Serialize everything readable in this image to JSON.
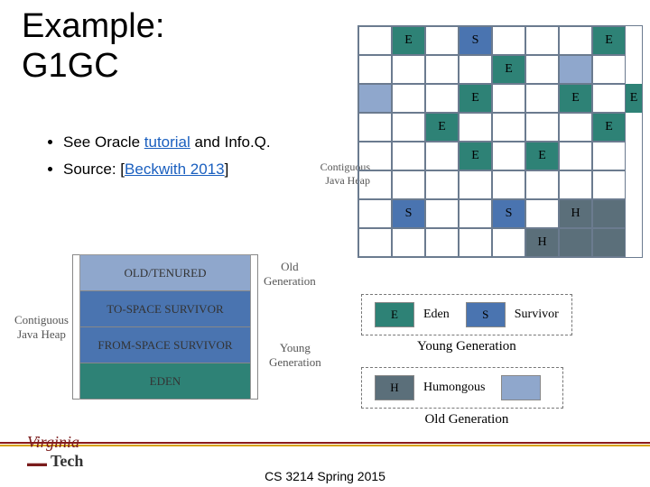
{
  "title_line1": "Example:",
  "title_line2": "G1GC",
  "bullet1_prefix": "See Oracle ",
  "bullet1_link": "tutorial",
  "bullet1_suffix": " and Info.Q.",
  "bullet2_prefix": "Source: [",
  "bullet2_link": "Beckwith 2013",
  "bullet2_suffix": "]",
  "footer": "CS 3214 Spring 2015",
  "logo1": "Virginia",
  "logo2": "Tech",
  "heap_label1": "Contiguous",
  "heap_label2": "Java Heap",
  "band_old": "OLD/TENURED",
  "band_to": "TO-SPACE SURVIVOR",
  "band_from": "FROM-SPACE SURVIVOR",
  "band_eden": "EDEN",
  "gen_old": "Old",
  "gen_label": "Generation",
  "gen_young": "Young",
  "leg_E": "E",
  "leg_Eden": "Eden",
  "leg_S": "S",
  "leg_Surv": "Survivor",
  "leg_H": "H",
  "leg_Hum": "Humongous",
  "leg_YG": "Young Generation",
  "leg_OG": "Old Generation",
  "grid_label1": "Contiguous",
  "grid_label2": "Java Heap"
}
